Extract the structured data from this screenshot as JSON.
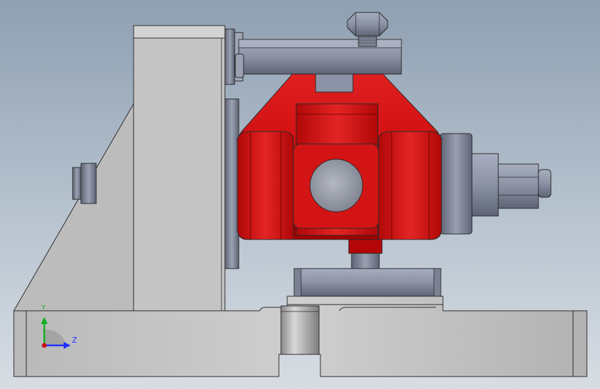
{
  "viewport": {
    "background_top": "#8fa0b2",
    "background_bottom": "#d7dde3"
  },
  "colors": {
    "steel_light": "#c9c9c9",
    "steel_mid": "#a8a8a8",
    "steel_dark": "#6e6e6e",
    "blue_steel": "#8c93a6",
    "blue_steel_dark": "#5a6070",
    "red_part": "#d21616",
    "red_dark": "#8a0000",
    "outline": "#2a2a2a"
  },
  "triad": {
    "x_axis_label": "Z",
    "y_axis_label": "Y",
    "z_color": "#2030ff",
    "y_color": "#10b020",
    "origin_color": "#cc1010"
  },
  "parts": [
    "base-plate",
    "angle-bracket",
    "clamp-arm",
    "hex-bolt",
    "red-clamp-body",
    "side-hub",
    "hex-nut-shaft",
    "pedestal-block",
    "bushing-pin"
  ]
}
